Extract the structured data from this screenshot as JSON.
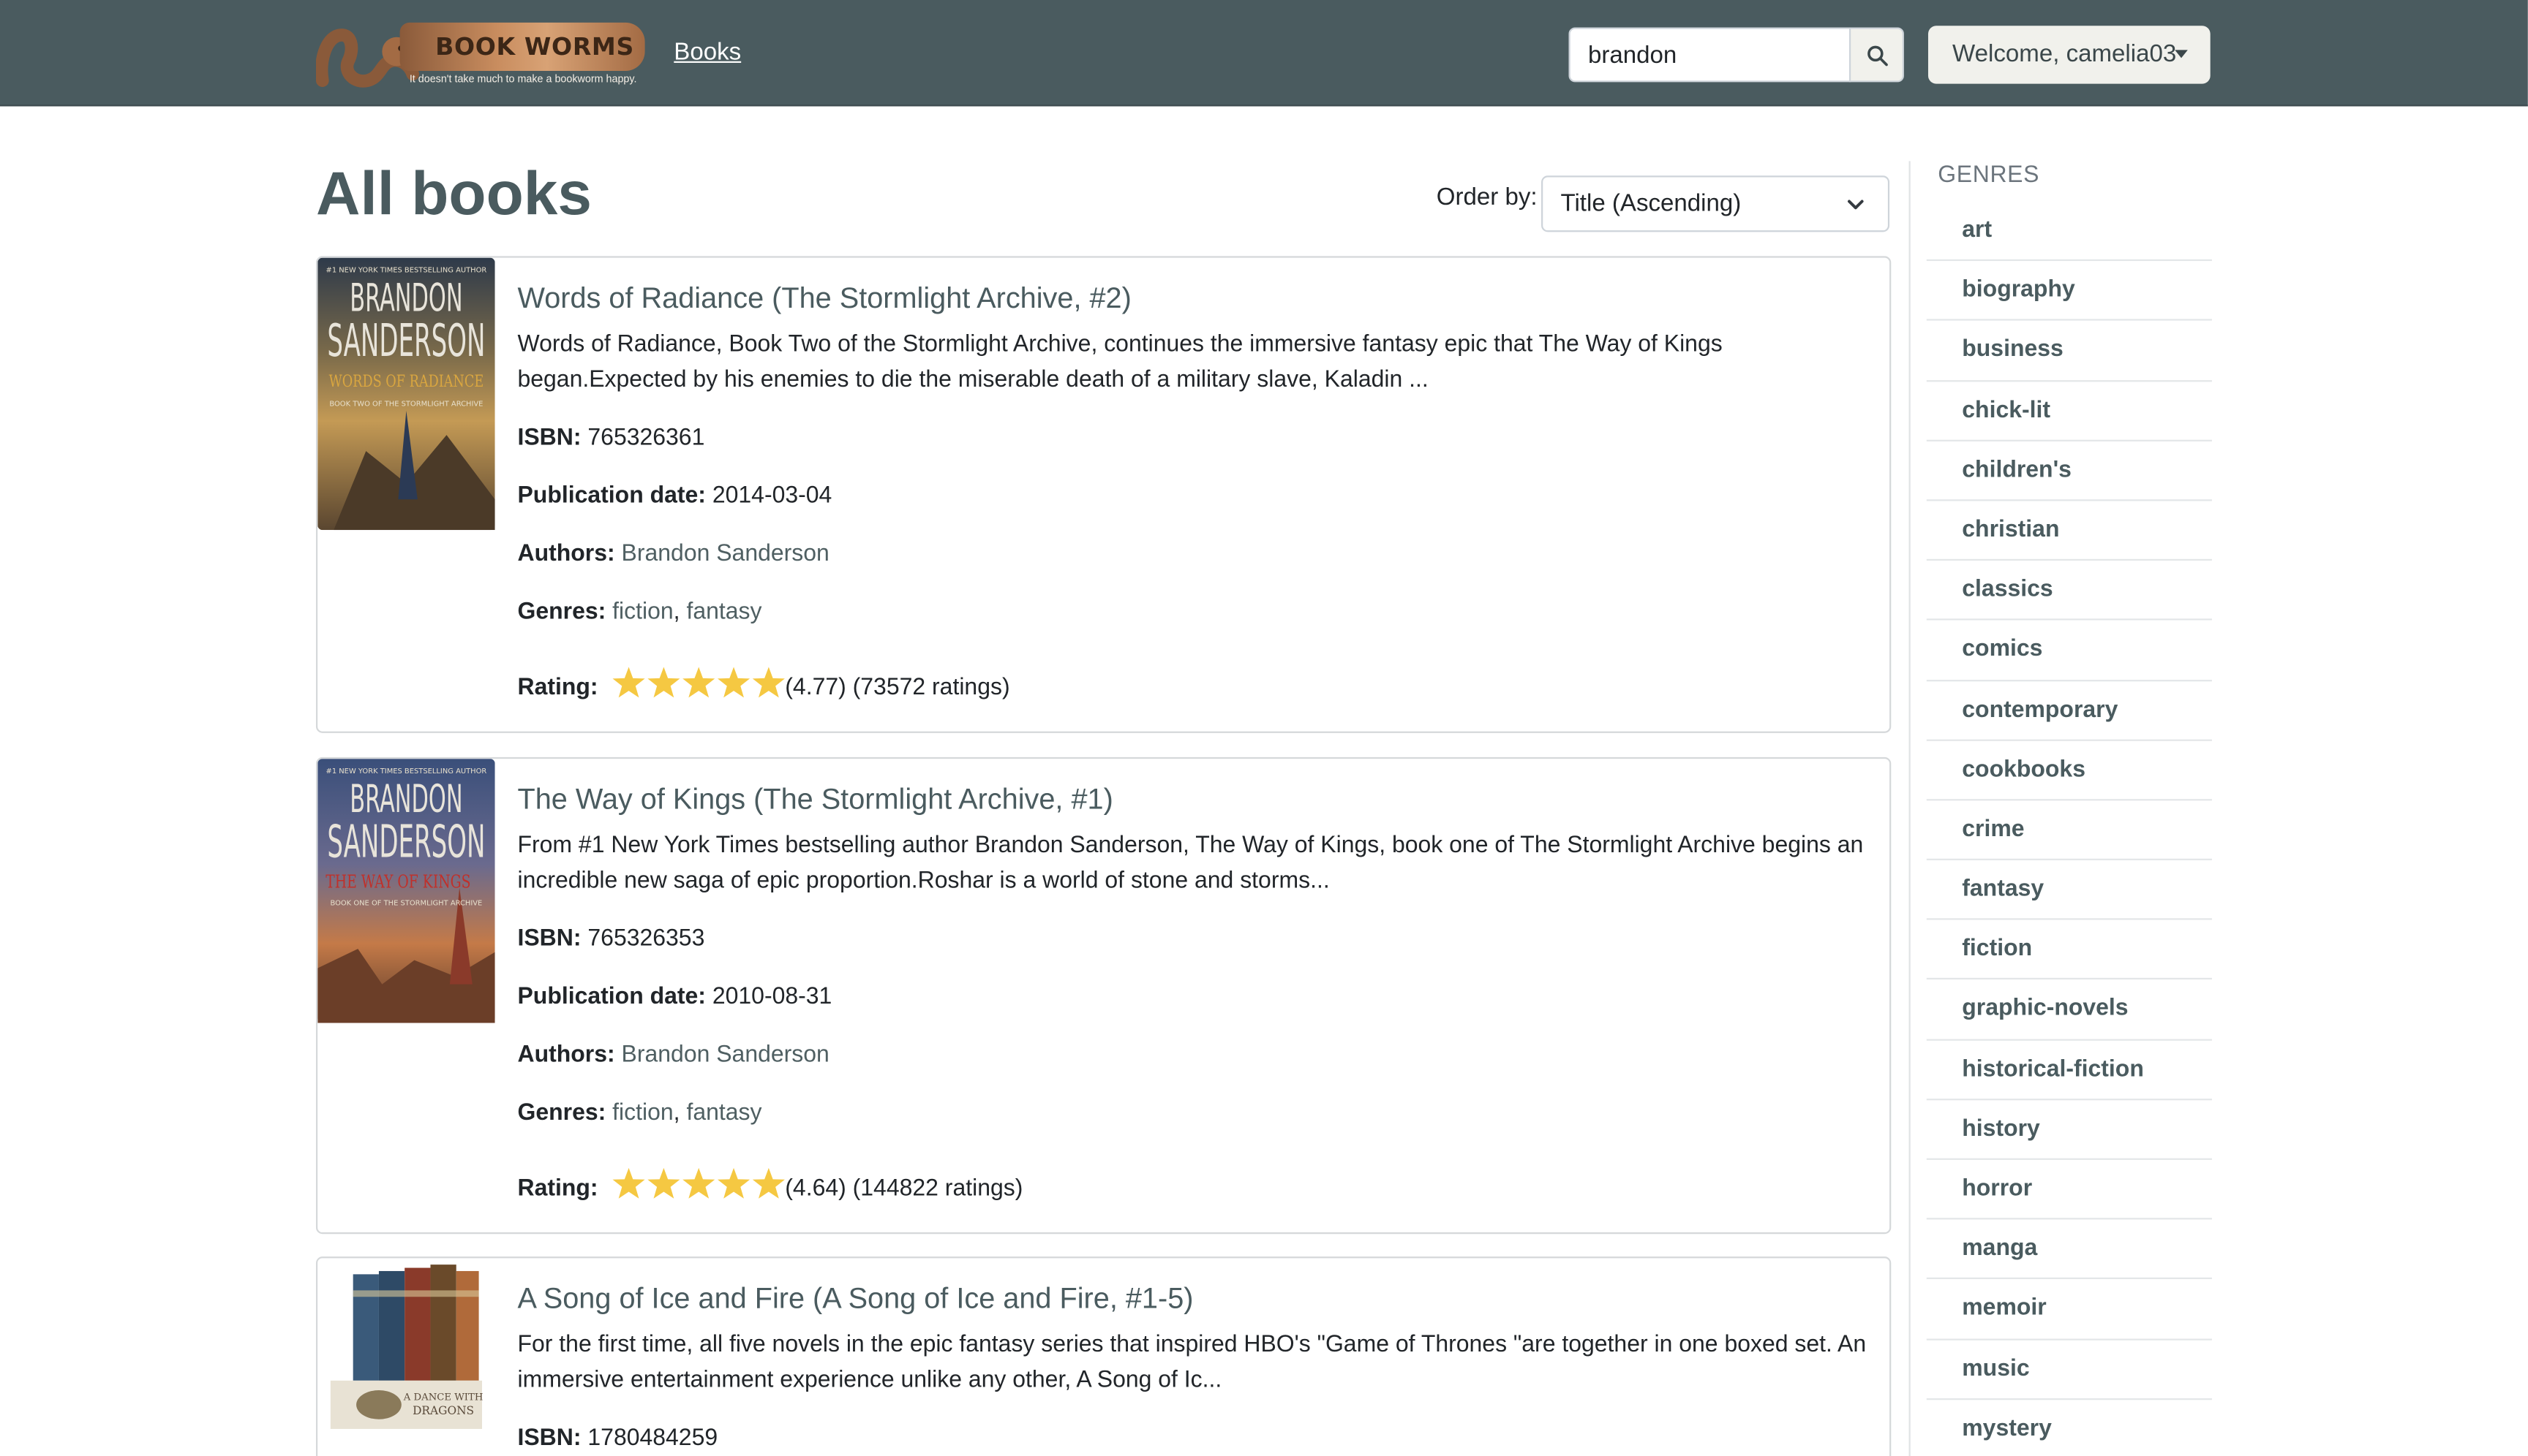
{
  "header": {
    "logo_title": "BOOK WORMS",
    "logo_tagline": "It doesn't take much to make a bookworm happy.",
    "nav_books": "Books",
    "search_value": "brandon",
    "user_menu": "Welcome, camelia03"
  },
  "main": {
    "title": "All books",
    "order_label": "Order by:",
    "order_value": "Title (Ascending)"
  },
  "labels": {
    "isbn": "ISBN:",
    "pubdate": "Publication date:",
    "authors": "Authors:",
    "genres": "Genres:",
    "rating": "Rating:"
  },
  "books": [
    {
      "title": "Words of Radiance (The Stormlight Archive, #2)",
      "description": "Words of Radiance, Book Two of the Stormlight Archive, continues the immersive fantasy epic that The Way of Kings began.Expected by his enemies to die the miserable death of a military slave, Kaladin ...",
      "isbn": "765326361",
      "pub_date": "2014-03-04",
      "author": "Brandon Sanderson",
      "genres": [
        "fiction",
        "fantasy"
      ],
      "rating": 4.77,
      "rating_text": "(4.77) (73572 ratings)",
      "cover": {
        "banner": "#1 NEW YORK TIMES BESTSELLING AUTHOR",
        "author_line1": "BRANDON",
        "author_line2": "SANDERSON",
        "book_title": "WORDS OF RADIANCE",
        "series": "BOOK TWO OF THE STORMLIGHT ARCHIVE"
      }
    },
    {
      "title": "The Way of Kings (The Stormlight Archive, #1)",
      "description": "From #1 New York Times bestselling author Brandon Sanderson, The Way of Kings, book one of The Stormlight Archive begins an incredible new saga of epic proportion.Roshar is a world of stone and storms...",
      "isbn": "765326353",
      "pub_date": "2010-08-31",
      "author": "Brandon Sanderson",
      "genres": [
        "fiction",
        "fantasy"
      ],
      "rating": 4.64,
      "rating_text": "(4.64) (144822 ratings)",
      "cover": {
        "banner": "#1 NEW YORK TIMES BESTSELLING AUTHOR",
        "author_line1": "BRANDON",
        "author_line2": "SANDERSON",
        "book_title": "THE WAY OF KINGS",
        "series": "BOOK ONE OF THE STORMLIGHT ARCHIVE"
      }
    },
    {
      "title": "A Song of Ice and Fire (A Song of Ice and Fire, #1-5)",
      "description": "For the first time, all five novels in the epic fantasy series that inspired HBO's \"Game of Thrones \"are together in one boxed set. An immersive entertainment experience unlike any other, A Song of Ic...",
      "isbn": "1780484259",
      "cover": {
        "box_text_1": "A DANCE WITH",
        "box_text_2": "DRAGONS"
      }
    }
  ],
  "sidebar": {
    "heading": "GENRES",
    "genres": [
      "art",
      "biography",
      "business",
      "chick-lit",
      "children's",
      "christian",
      "classics",
      "comics",
      "contemporary",
      "cookbooks",
      "crime",
      "fantasy",
      "fiction",
      "graphic-novels",
      "historical-fiction",
      "history",
      "horror",
      "manga",
      "memoir",
      "music",
      "mystery"
    ]
  },
  "colors": {
    "navbar": "#4a5b5f",
    "star": "#f5c842",
    "text_dark": "#212529",
    "link": "#4f5f62"
  }
}
